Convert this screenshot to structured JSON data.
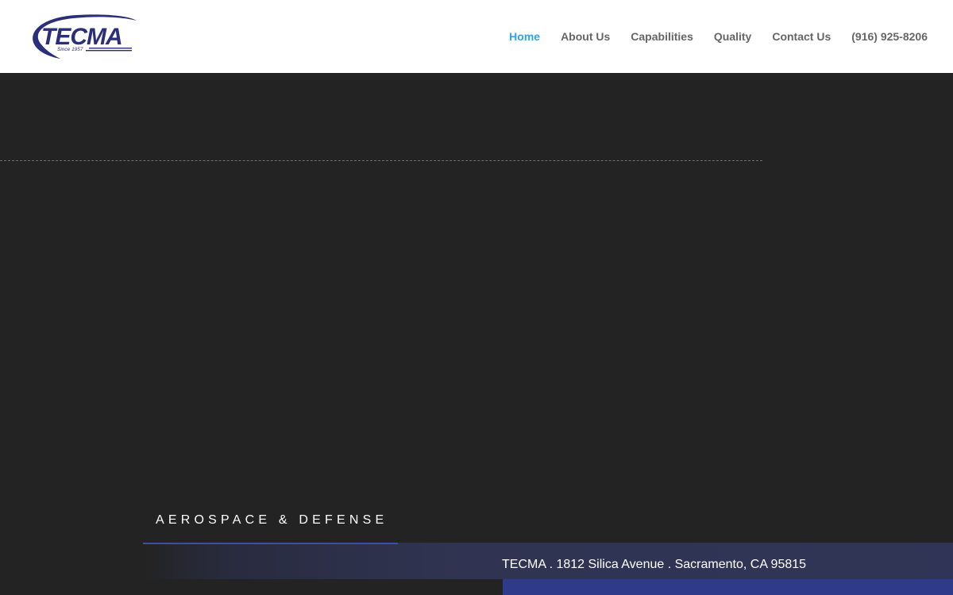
{
  "logo": {
    "text": "TECMA",
    "since": "Since 1957"
  },
  "nav": {
    "items": [
      {
        "label": "Home",
        "active": true
      },
      {
        "label": "About Us",
        "active": false
      },
      {
        "label": "Capabilities",
        "active": false
      },
      {
        "label": "Quality",
        "active": false
      },
      {
        "label": "Contact Us",
        "active": false
      },
      {
        "label": "(916) 925-8206",
        "active": false
      }
    ]
  },
  "hero": {
    "tagline": "AEROSPACE & DEFENSE",
    "address": "TECMA . 1812 Silica Avenue . Sacramento, CA 95815"
  },
  "colors": {
    "nav_active": "#2ea3f2",
    "nav_text": "#666666",
    "hero_bg": "#232323",
    "brand_navy": "#2b2e7a",
    "accent_band": "#2f3a8a"
  }
}
